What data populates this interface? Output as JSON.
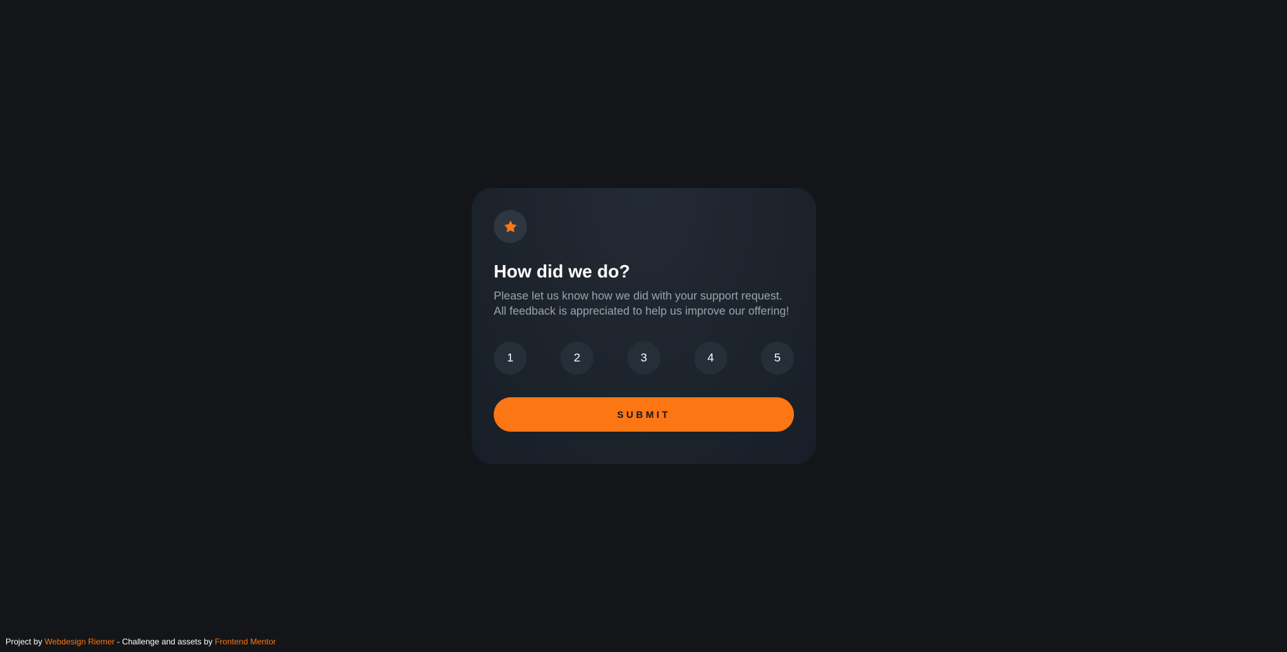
{
  "card": {
    "icon": "star-icon",
    "title": "How did we do?",
    "description": "Please let us know how we did with your support request. All feedback is appreciated to help us improve our offering!",
    "ratings": [
      "1",
      "2",
      "3",
      "4",
      "5"
    ],
    "submit_label": "SUBMIT"
  },
  "attribution": {
    "prefix": "Project by",
    "author_link": "Webdesign Riemer",
    "middle": "- Challenge and assets by",
    "challenge_link": "Frontend Mentor"
  },
  "colors": {
    "background": "#131518",
    "card": "#1d232b",
    "accent": "#fc7614",
    "rating_bg": "#262e38",
    "text_muted": "#9aa3ad"
  }
}
